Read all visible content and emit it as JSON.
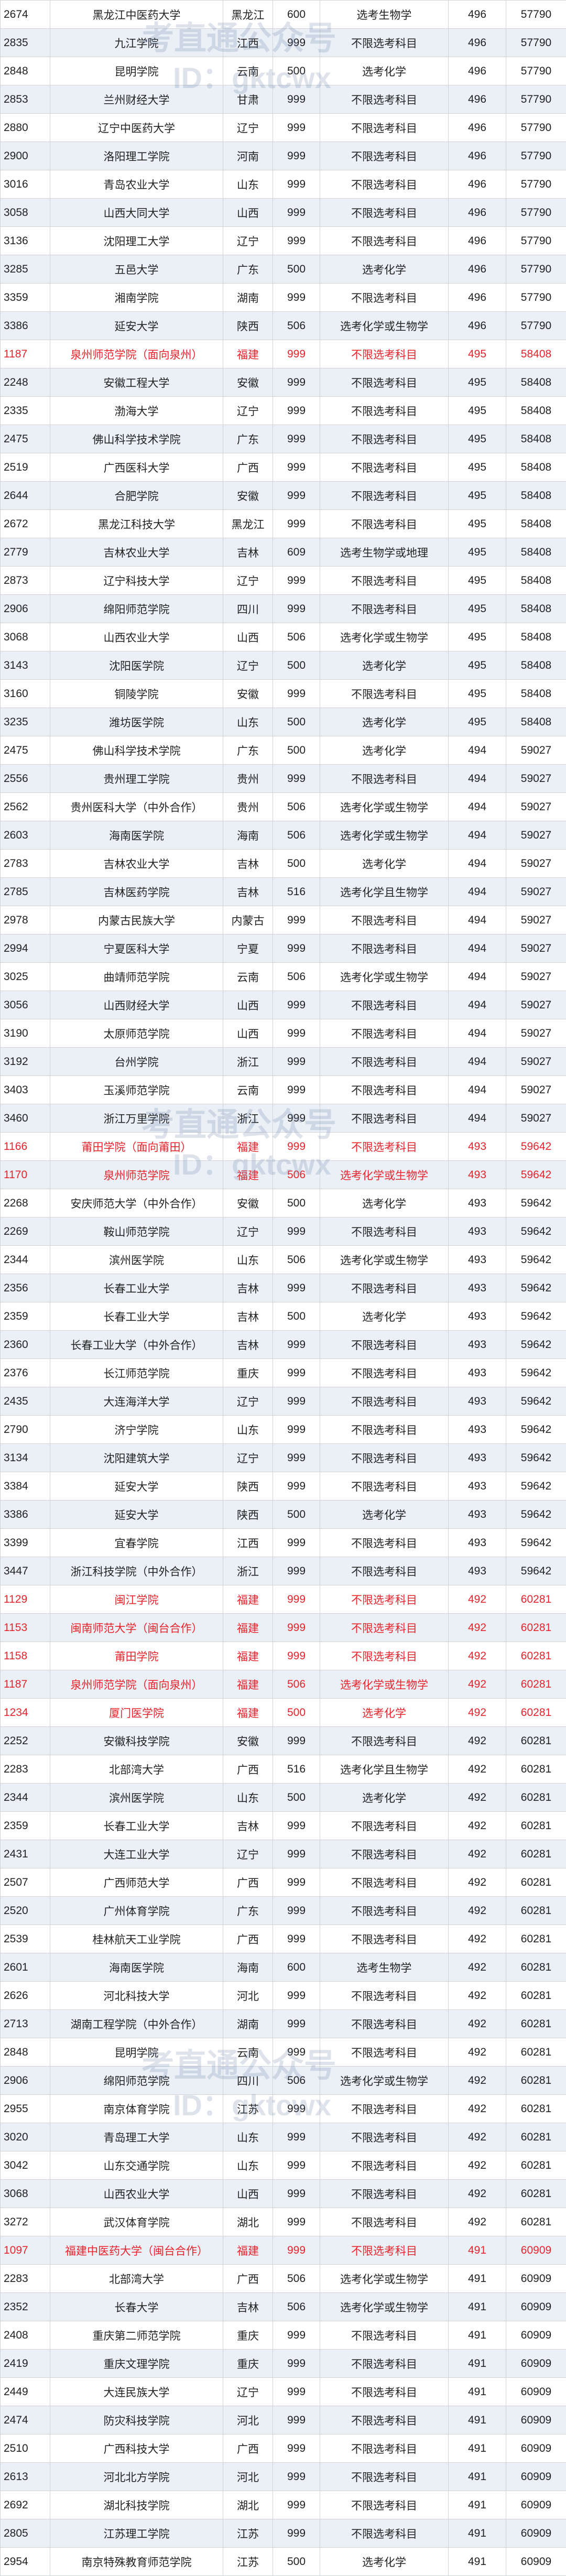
{
  "watermark": {
    "text": "考直通公众号",
    "id": "ID：gktcwx"
  },
  "rows": [
    {
      "code": "2674",
      "name": "黑龙江中医药大学",
      "province": "黑龙江",
      "plan": "600",
      "subject": "选考生物学",
      "score": "496",
      "rank": "57790",
      "hl": false
    },
    {
      "code": "2835",
      "name": "九江学院",
      "province": "江西",
      "plan": "999",
      "subject": "不限选考科目",
      "score": "496",
      "rank": "57790",
      "hl": false
    },
    {
      "code": "2848",
      "name": "昆明学院",
      "province": "云南",
      "plan": "500",
      "subject": "选考化学",
      "score": "496",
      "rank": "57790",
      "hl": false
    },
    {
      "code": "2853",
      "name": "兰州财经大学",
      "province": "甘肃",
      "plan": "999",
      "subject": "不限选考科目",
      "score": "496",
      "rank": "57790",
      "hl": false
    },
    {
      "code": "2880",
      "name": "辽宁中医药大学",
      "province": "辽宁",
      "plan": "999",
      "subject": "不限选考科目",
      "score": "496",
      "rank": "57790",
      "hl": false
    },
    {
      "code": "2900",
      "name": "洛阳理工学院",
      "province": "河南",
      "plan": "999",
      "subject": "不限选考科目",
      "score": "496",
      "rank": "57790",
      "hl": false
    },
    {
      "code": "3016",
      "name": "青岛农业大学",
      "province": "山东",
      "plan": "999",
      "subject": "不限选考科目",
      "score": "496",
      "rank": "57790",
      "hl": false
    },
    {
      "code": "3058",
      "name": "山西大同大学",
      "province": "山西",
      "plan": "999",
      "subject": "不限选考科目",
      "score": "496",
      "rank": "57790",
      "hl": false
    },
    {
      "code": "3136",
      "name": "沈阳理工大学",
      "province": "辽宁",
      "plan": "999",
      "subject": "不限选考科目",
      "score": "496",
      "rank": "57790",
      "hl": false
    },
    {
      "code": "3285",
      "name": "五邑大学",
      "province": "广东",
      "plan": "500",
      "subject": "选考化学",
      "score": "496",
      "rank": "57790",
      "hl": false
    },
    {
      "code": "3359",
      "name": "湘南学院",
      "province": "湖南",
      "plan": "999",
      "subject": "不限选考科目",
      "score": "496",
      "rank": "57790",
      "hl": false
    },
    {
      "code": "3386",
      "name": "延安大学",
      "province": "陕西",
      "plan": "506",
      "subject": "选考化学或生物学",
      "score": "496",
      "rank": "57790",
      "hl": false
    },
    {
      "code": "1187",
      "name": "泉州师范学院（面向泉州）",
      "province": "福建",
      "plan": "999",
      "subject": "不限选考科目",
      "score": "495",
      "rank": "58408",
      "hl": true
    },
    {
      "code": "2248",
      "name": "安徽工程大学",
      "province": "安徽",
      "plan": "999",
      "subject": "不限选考科目",
      "score": "495",
      "rank": "58408",
      "hl": false
    },
    {
      "code": "2335",
      "name": "渤海大学",
      "province": "辽宁",
      "plan": "999",
      "subject": "不限选考科目",
      "score": "495",
      "rank": "58408",
      "hl": false
    },
    {
      "code": "2475",
      "name": "佛山科学技术学院",
      "province": "广东",
      "plan": "999",
      "subject": "不限选考科目",
      "score": "495",
      "rank": "58408",
      "hl": false
    },
    {
      "code": "2519",
      "name": "广西医科大学",
      "province": "广西",
      "plan": "999",
      "subject": "不限选考科目",
      "score": "495",
      "rank": "58408",
      "hl": false
    },
    {
      "code": "2644",
      "name": "合肥学院",
      "province": "安徽",
      "plan": "999",
      "subject": "不限选考科目",
      "score": "495",
      "rank": "58408",
      "hl": false
    },
    {
      "code": "2672",
      "name": "黑龙江科技大学",
      "province": "黑龙江",
      "plan": "999",
      "subject": "不限选考科目",
      "score": "495",
      "rank": "58408",
      "hl": false
    },
    {
      "code": "2779",
      "name": "吉林农业大学",
      "province": "吉林",
      "plan": "609",
      "subject": "选考生物学或地理",
      "score": "495",
      "rank": "58408",
      "hl": false
    },
    {
      "code": "2873",
      "name": "辽宁科技大学",
      "province": "辽宁",
      "plan": "999",
      "subject": "不限选考科目",
      "score": "495",
      "rank": "58408",
      "hl": false
    },
    {
      "code": "2906",
      "name": "绵阳师范学院",
      "province": "四川",
      "plan": "999",
      "subject": "不限选考科目",
      "score": "495",
      "rank": "58408",
      "hl": false
    },
    {
      "code": "3068",
      "name": "山西农业大学",
      "province": "山西",
      "plan": "506",
      "subject": "选考化学或生物学",
      "score": "495",
      "rank": "58408",
      "hl": false
    },
    {
      "code": "3143",
      "name": "沈阳医学院",
      "province": "辽宁",
      "plan": "500",
      "subject": "选考化学",
      "score": "495",
      "rank": "58408",
      "hl": false
    },
    {
      "code": "3160",
      "name": "铜陵学院",
      "province": "安徽",
      "plan": "999",
      "subject": "不限选考科目",
      "score": "495",
      "rank": "58408",
      "hl": false
    },
    {
      "code": "3235",
      "name": "潍坊医学院",
      "province": "山东",
      "plan": "500",
      "subject": "选考化学",
      "score": "495",
      "rank": "58408",
      "hl": false
    },
    {
      "code": "2475",
      "name": "佛山科学技术学院",
      "province": "广东",
      "plan": "500",
      "subject": "选考化学",
      "score": "494",
      "rank": "59027",
      "hl": false
    },
    {
      "code": "2556",
      "name": "贵州理工学院",
      "province": "贵州",
      "plan": "999",
      "subject": "不限选考科目",
      "score": "494",
      "rank": "59027",
      "hl": false
    },
    {
      "code": "2562",
      "name": "贵州医科大学（中外合作）",
      "province": "贵州",
      "plan": "506",
      "subject": "选考化学或生物学",
      "score": "494",
      "rank": "59027",
      "hl": false
    },
    {
      "code": "2603",
      "name": "海南医学院",
      "province": "海南",
      "plan": "506",
      "subject": "选考化学或生物学",
      "score": "494",
      "rank": "59027",
      "hl": false
    },
    {
      "code": "2783",
      "name": "吉林农业大学",
      "province": "吉林",
      "plan": "500",
      "subject": "选考化学",
      "score": "494",
      "rank": "59027",
      "hl": false
    },
    {
      "code": "2785",
      "name": "吉林医药学院",
      "province": "吉林",
      "plan": "516",
      "subject": "选考化学且生物学",
      "score": "494",
      "rank": "59027",
      "hl": false
    },
    {
      "code": "2978",
      "name": "内蒙古民族大学",
      "province": "内蒙古",
      "plan": "999",
      "subject": "不限选考科目",
      "score": "494",
      "rank": "59027",
      "hl": false
    },
    {
      "code": "2994",
      "name": "宁夏医科大学",
      "province": "宁夏",
      "plan": "999",
      "subject": "不限选考科目",
      "score": "494",
      "rank": "59027",
      "hl": false
    },
    {
      "code": "3025",
      "name": "曲靖师范学院",
      "province": "云南",
      "plan": "506",
      "subject": "选考化学或生物学",
      "score": "494",
      "rank": "59027",
      "hl": false
    },
    {
      "code": "3056",
      "name": "山西财经大学",
      "province": "山西",
      "plan": "999",
      "subject": "不限选考科目",
      "score": "494",
      "rank": "59027",
      "hl": false
    },
    {
      "code": "3190",
      "name": "太原师范学院",
      "province": "山西",
      "plan": "999",
      "subject": "不限选考科目",
      "score": "494",
      "rank": "59027",
      "hl": false
    },
    {
      "code": "3192",
      "name": "台州学院",
      "province": "浙江",
      "plan": "999",
      "subject": "不限选考科目",
      "score": "494",
      "rank": "59027",
      "hl": false
    },
    {
      "code": "3403",
      "name": "玉溪师范学院",
      "province": "云南",
      "plan": "999",
      "subject": "不限选考科目",
      "score": "494",
      "rank": "59027",
      "hl": false
    },
    {
      "code": "3460",
      "name": "浙江万里学院",
      "province": "浙江",
      "plan": "999",
      "subject": "不限选考科目",
      "score": "494",
      "rank": "59027",
      "hl": false
    },
    {
      "code": "1166",
      "name": "莆田学院（面向莆田）",
      "province": "福建",
      "plan": "999",
      "subject": "不限选考科目",
      "score": "493",
      "rank": "59642",
      "hl": true
    },
    {
      "code": "1170",
      "name": "泉州师范学院",
      "province": "福建",
      "plan": "506",
      "subject": "选考化学或生物学",
      "score": "493",
      "rank": "59642",
      "hl": true
    },
    {
      "code": "2268",
      "name": "安庆师范大学（中外合作）",
      "province": "安徽",
      "plan": "500",
      "subject": "选考化学",
      "score": "493",
      "rank": "59642",
      "hl": false
    },
    {
      "code": "2269",
      "name": "鞍山师范学院",
      "province": "辽宁",
      "plan": "999",
      "subject": "不限选考科目",
      "score": "493",
      "rank": "59642",
      "hl": false
    },
    {
      "code": "2344",
      "name": "滨州医学院",
      "province": "山东",
      "plan": "506",
      "subject": "选考化学或生物学",
      "score": "493",
      "rank": "59642",
      "hl": false
    },
    {
      "code": "2356",
      "name": "长春工业大学",
      "province": "吉林",
      "plan": "999",
      "subject": "不限选考科目",
      "score": "493",
      "rank": "59642",
      "hl": false
    },
    {
      "code": "2359",
      "name": "长春工业大学",
      "province": "吉林",
      "plan": "500",
      "subject": "选考化学",
      "score": "493",
      "rank": "59642",
      "hl": false
    },
    {
      "code": "2360",
      "name": "长春工业大学（中外合作）",
      "province": "吉林",
      "plan": "999",
      "subject": "不限选考科目",
      "score": "493",
      "rank": "59642",
      "hl": false
    },
    {
      "code": "2376",
      "name": "长江师范学院",
      "province": "重庆",
      "plan": "999",
      "subject": "不限选考科目",
      "score": "493",
      "rank": "59642",
      "hl": false
    },
    {
      "code": "2435",
      "name": "大连海洋大学",
      "province": "辽宁",
      "plan": "999",
      "subject": "不限选考科目",
      "score": "493",
      "rank": "59642",
      "hl": false
    },
    {
      "code": "2790",
      "name": "济宁学院",
      "province": "山东",
      "plan": "999",
      "subject": "不限选考科目",
      "score": "493",
      "rank": "59642",
      "hl": false
    },
    {
      "code": "3134",
      "name": "沈阳建筑大学",
      "province": "辽宁",
      "plan": "999",
      "subject": "不限选考科目",
      "score": "493",
      "rank": "59642",
      "hl": false
    },
    {
      "code": "3384",
      "name": "延安大学",
      "province": "陕西",
      "plan": "999",
      "subject": "不限选考科目",
      "score": "493",
      "rank": "59642",
      "hl": false
    },
    {
      "code": "3386",
      "name": "延安大学",
      "province": "陕西",
      "plan": "500",
      "subject": "选考化学",
      "score": "493",
      "rank": "59642",
      "hl": false
    },
    {
      "code": "3399",
      "name": "宜春学院",
      "province": "江西",
      "plan": "999",
      "subject": "不限选考科目",
      "score": "493",
      "rank": "59642",
      "hl": false
    },
    {
      "code": "3447",
      "name": "浙江科技学院（中外合作）",
      "province": "浙江",
      "plan": "999",
      "subject": "不限选考科目",
      "score": "493",
      "rank": "59642",
      "hl": false
    },
    {
      "code": "1129",
      "name": "闽江学院",
      "province": "福建",
      "plan": "999",
      "subject": "不限选考科目",
      "score": "492",
      "rank": "60281",
      "hl": true
    },
    {
      "code": "1153",
      "name": "闽南师范大学（闽台合作）",
      "province": "福建",
      "plan": "999",
      "subject": "不限选考科目",
      "score": "492",
      "rank": "60281",
      "hl": true
    },
    {
      "code": "1158",
      "name": "莆田学院",
      "province": "福建",
      "plan": "999",
      "subject": "不限选考科目",
      "score": "492",
      "rank": "60281",
      "hl": true
    },
    {
      "code": "1187",
      "name": "泉州师范学院（面向泉州）",
      "province": "福建",
      "plan": "506",
      "subject": "选考化学或生物学",
      "score": "492",
      "rank": "60281",
      "hl": true
    },
    {
      "code": "1234",
      "name": "厦门医学院",
      "province": "福建",
      "plan": "500",
      "subject": "选考化学",
      "score": "492",
      "rank": "60281",
      "hl": true
    },
    {
      "code": "2252",
      "name": "安徽科技学院",
      "province": "安徽",
      "plan": "999",
      "subject": "不限选考科目",
      "score": "492",
      "rank": "60281",
      "hl": false
    },
    {
      "code": "2283",
      "name": "北部湾大学",
      "province": "广西",
      "plan": "516",
      "subject": "选考化学且生物学",
      "score": "492",
      "rank": "60281",
      "hl": false
    },
    {
      "code": "2344",
      "name": "滨州医学院",
      "province": "山东",
      "plan": "500",
      "subject": "选考化学",
      "score": "492",
      "rank": "60281",
      "hl": false
    },
    {
      "code": "2359",
      "name": "长春工业大学",
      "province": "吉林",
      "plan": "999",
      "subject": "不限选考科目",
      "score": "492",
      "rank": "60281",
      "hl": false
    },
    {
      "code": "2431",
      "name": "大连工业大学",
      "province": "辽宁",
      "plan": "999",
      "subject": "不限选考科目",
      "score": "492",
      "rank": "60281",
      "hl": false
    },
    {
      "code": "2507",
      "name": "广西师范大学",
      "province": "广西",
      "plan": "999",
      "subject": "不限选考科目",
      "score": "492",
      "rank": "60281",
      "hl": false
    },
    {
      "code": "2520",
      "name": "广州体育学院",
      "province": "广东",
      "plan": "999",
      "subject": "不限选考科目",
      "score": "492",
      "rank": "60281",
      "hl": false
    },
    {
      "code": "2539",
      "name": "桂林航天工业学院",
      "province": "广西",
      "plan": "999",
      "subject": "不限选考科目",
      "score": "492",
      "rank": "60281",
      "hl": false
    },
    {
      "code": "2601",
      "name": "海南医学院",
      "province": "海南",
      "plan": "600",
      "subject": "选考生物学",
      "score": "492",
      "rank": "60281",
      "hl": false
    },
    {
      "code": "2626",
      "name": "河北科技大学",
      "province": "河北",
      "plan": "999",
      "subject": "不限选考科目",
      "score": "492",
      "rank": "60281",
      "hl": false
    },
    {
      "code": "2713",
      "name": "湖南工程学院（中外合作）",
      "province": "湖南",
      "plan": "999",
      "subject": "不限选考科目",
      "score": "492",
      "rank": "60281",
      "hl": false
    },
    {
      "code": "2848",
      "name": "昆明学院",
      "province": "云南",
      "plan": "999",
      "subject": "不限选考科目",
      "score": "492",
      "rank": "60281",
      "hl": false
    },
    {
      "code": "2906",
      "name": "绵阳师范学院",
      "province": "四川",
      "plan": "506",
      "subject": "选考化学或生物学",
      "score": "492",
      "rank": "60281",
      "hl": false
    },
    {
      "code": "2955",
      "name": "南京体育学院",
      "province": "江苏",
      "plan": "999",
      "subject": "不限选考科目",
      "score": "492",
      "rank": "60281",
      "hl": false
    },
    {
      "code": "3020",
      "name": "青岛理工大学",
      "province": "山东",
      "plan": "999",
      "subject": "不限选考科目",
      "score": "492",
      "rank": "60281",
      "hl": false
    },
    {
      "code": "3042",
      "name": "山东交通学院",
      "province": "山东",
      "plan": "999",
      "subject": "不限选考科目",
      "score": "492",
      "rank": "60281",
      "hl": false
    },
    {
      "code": "3068",
      "name": "山西农业大学",
      "province": "山西",
      "plan": "999",
      "subject": "不限选考科目",
      "score": "492",
      "rank": "60281",
      "hl": false
    },
    {
      "code": "3272",
      "name": "武汉体育学院",
      "province": "湖北",
      "plan": "999",
      "subject": "不限选考科目",
      "score": "492",
      "rank": "60281",
      "hl": false
    },
    {
      "code": "1097",
      "name": "福建中医药大学（闽台合作）",
      "province": "福建",
      "plan": "999",
      "subject": "不限选考科目",
      "score": "491",
      "rank": "60909",
      "hl": true
    },
    {
      "code": "2283",
      "name": "北部湾大学",
      "province": "广西",
      "plan": "506",
      "subject": "选考化学或生物学",
      "score": "491",
      "rank": "60909",
      "hl": false
    },
    {
      "code": "2352",
      "name": "长春大学",
      "province": "吉林",
      "plan": "506",
      "subject": "选考化学或生物学",
      "score": "491",
      "rank": "60909",
      "hl": false
    },
    {
      "code": "2408",
      "name": "重庆第二师范学院",
      "province": "重庆",
      "plan": "999",
      "subject": "不限选考科目",
      "score": "491",
      "rank": "60909",
      "hl": false
    },
    {
      "code": "2419",
      "name": "重庆文理学院",
      "province": "重庆",
      "plan": "999",
      "subject": "不限选考科目",
      "score": "491",
      "rank": "60909",
      "hl": false
    },
    {
      "code": "2449",
      "name": "大连民族大学",
      "province": "辽宁",
      "plan": "999",
      "subject": "不限选考科目",
      "score": "491",
      "rank": "60909",
      "hl": false
    },
    {
      "code": "2474",
      "name": "防灾科技学院",
      "province": "河北",
      "plan": "999",
      "subject": "不限选考科目",
      "score": "491",
      "rank": "60909",
      "hl": false
    },
    {
      "code": "2510",
      "name": "广西科技大学",
      "province": "广西",
      "plan": "999",
      "subject": "不限选考科目",
      "score": "491",
      "rank": "60909",
      "hl": false
    },
    {
      "code": "2613",
      "name": "河北北方学院",
      "province": "河北",
      "plan": "999",
      "subject": "不限选考科目",
      "score": "491",
      "rank": "60909",
      "hl": false
    },
    {
      "code": "2692",
      "name": "湖北科技学院",
      "province": "湖北",
      "plan": "999",
      "subject": "不限选考科目",
      "score": "491",
      "rank": "60909",
      "hl": false
    },
    {
      "code": "2805",
      "name": "江苏理工学院",
      "province": "江苏",
      "plan": "999",
      "subject": "不限选考科目",
      "score": "491",
      "rank": "60909",
      "hl": false
    },
    {
      "code": "2954",
      "name": "南京特殊教育师范学院",
      "province": "江苏",
      "plan": "500",
      "subject": "选考化学",
      "score": "491",
      "rank": "60909",
      "hl": false
    }
  ]
}
